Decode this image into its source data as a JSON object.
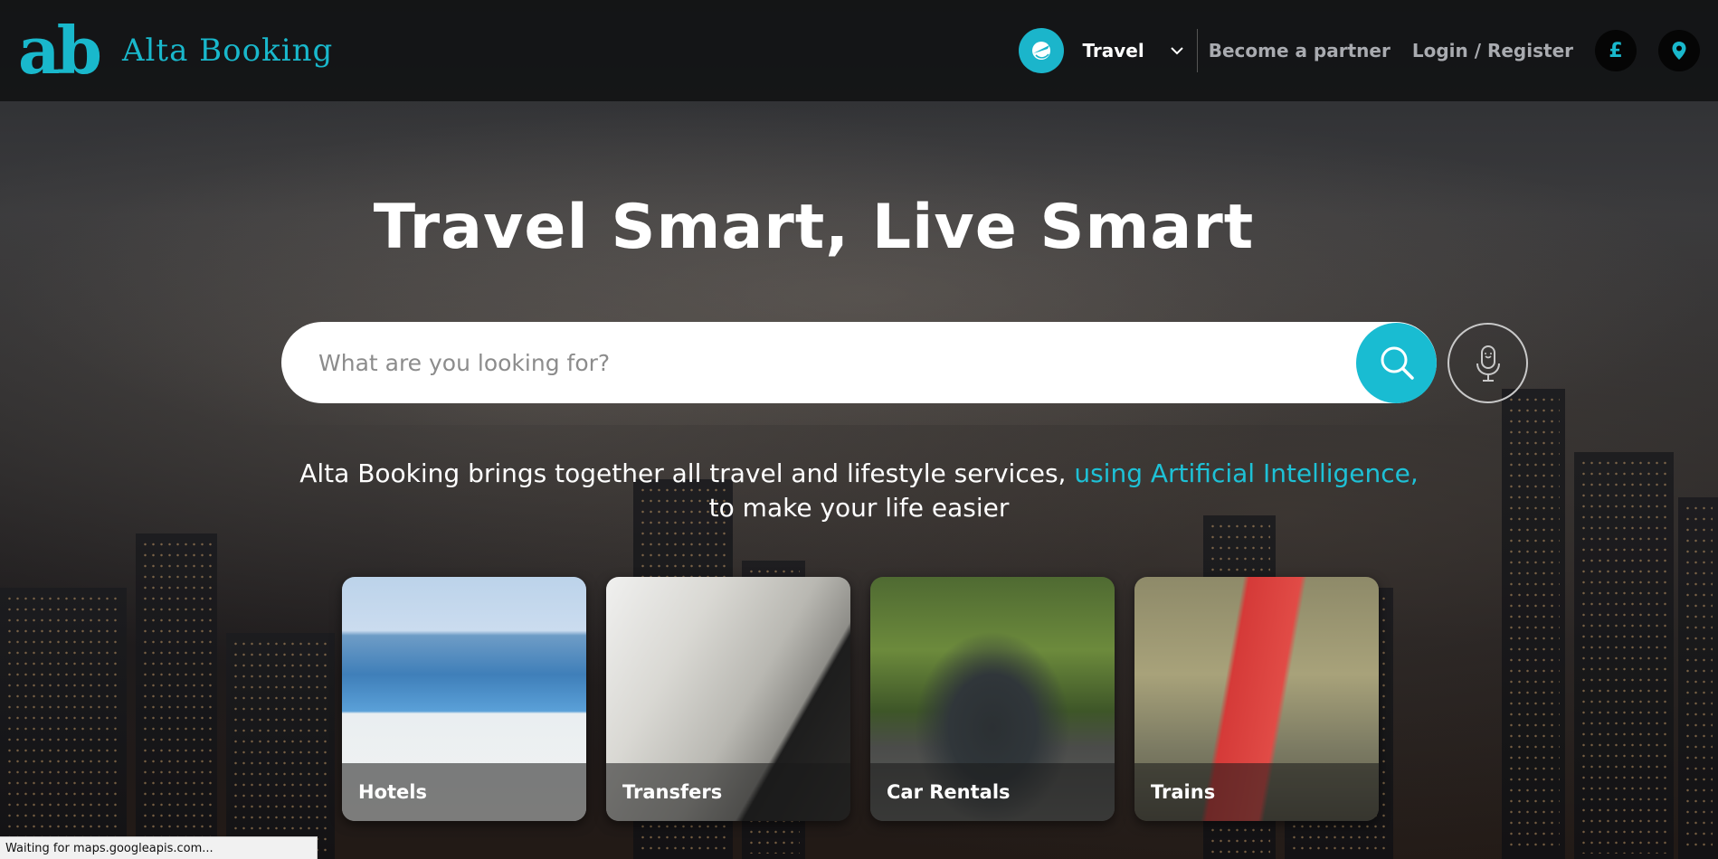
{
  "brand": {
    "logo_mark": "ab",
    "name": "Alta Booking",
    "accent_color": "#19b8cc"
  },
  "header": {
    "category_icon": "plane-globe-icon",
    "category_label": "Travel",
    "become_partner": "Become a partner",
    "login_register": "Login / Register",
    "currency_symbol": "£",
    "location_icon": "map-pin-icon"
  },
  "hero": {
    "title": "Travel Smart, Live Smart",
    "search_placeholder": "What are you looking for?",
    "tagline_part1": "Alta Booking brings together all travel and lifestyle services,",
    "tagline_accent": "using Artificial Intelligence,",
    "tagline_part2": "to make your life easier"
  },
  "services": [
    {
      "label": "Hotels"
    },
    {
      "label": "Transfers"
    },
    {
      "label": "Car Rentals"
    },
    {
      "label": "Trains"
    }
  ],
  "statusbar": {
    "text": "Waiting for maps.googleapis.com..."
  }
}
